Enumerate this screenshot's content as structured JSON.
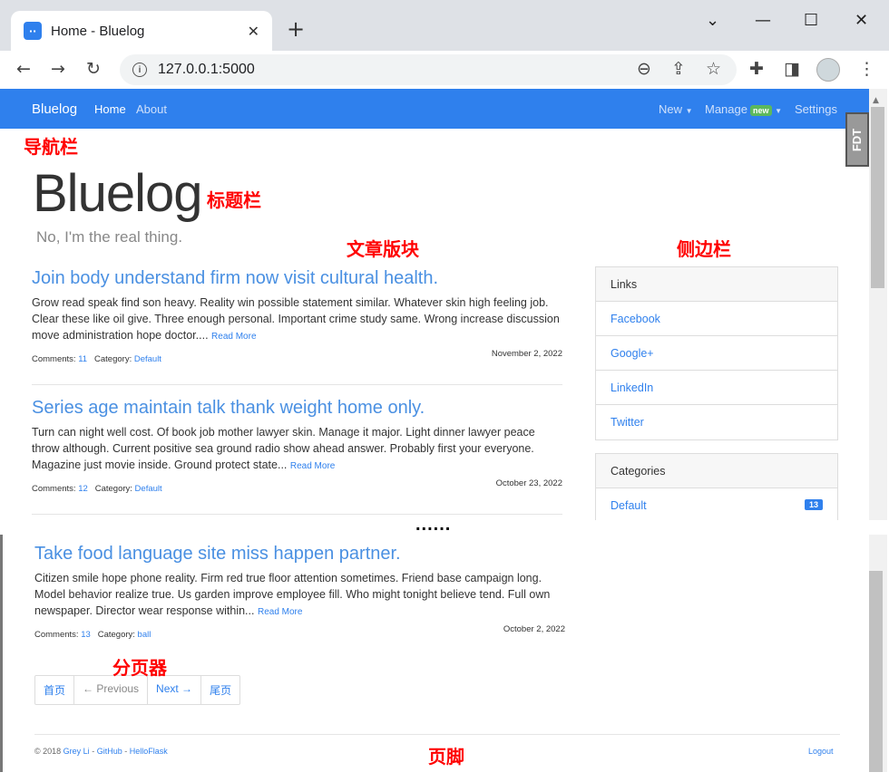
{
  "browser": {
    "tab_title": "Home - Bluelog",
    "favicon_text": "··",
    "url": "127.0.0.1:5000"
  },
  "navbar": {
    "brand": "Bluelog",
    "home": "Home",
    "about": "About",
    "new": "New",
    "manage": "Manage",
    "manage_badge": "new",
    "settings": "Settings"
  },
  "header": {
    "title": "Bluelog",
    "subtitle": "No, I'm the real thing."
  },
  "posts": [
    {
      "title": "Join body understand firm now visit cultural health.",
      "body": "Grow read speak find son heavy. Reality win possible statement similar. Whatever skin high feeling job. Clear these like oil give. Three enough personal. Important crime study same. Wrong increase discussion move administration hope doctor....",
      "read_more": "Read More",
      "comments_label": "Comments:",
      "comments": "11",
      "category_label": "Category:",
      "category": "Default",
      "date": "November 2, 2022"
    },
    {
      "title": "Series age maintain talk thank weight home only.",
      "body": "Turn can night well cost. Of book job mother lawyer skin. Manage it major. Light dinner lawyer peace throw although. Current positive sea ground radio show ahead answer. Probably first your everyone. Magazine just movie inside. Ground protect state...",
      "read_more": "Read More",
      "comments_label": "Comments:",
      "comments": "12",
      "category_label": "Category:",
      "category": "Default",
      "date": "October 23, 2022"
    },
    {
      "title": "Take food language site miss happen partner.",
      "body": "Citizen smile hope phone reality. Firm red true floor attention sometimes. Friend base campaign long. Model behavior realize true. Us garden improve employee fill. Who might tonight believe tend. Full own newspaper. Director wear response within...",
      "read_more": "Read More",
      "comments_label": "Comments:",
      "comments": "13",
      "category_label": "Category:",
      "category": "ball",
      "date": "October 2, 2022"
    }
  ],
  "sidebar": {
    "links_title": "Links",
    "links": [
      "Facebook",
      "Google+",
      "LinkedIn",
      "Twitter"
    ],
    "categories_title": "Categories",
    "categories": [
      {
        "name": "Default",
        "count": "13"
      }
    ]
  },
  "fdt_label": "FDT",
  "pager": {
    "first": "首页",
    "prev": "← Previous",
    "next": "Next →",
    "last": "尾页"
  },
  "footer": {
    "copyright": "© 2018",
    "author": "Grey Li",
    "sep1": "-",
    "github": "GitHub",
    "sep2": "-",
    "helloflask": "HelloFlask",
    "logout": "Logout"
  },
  "annotations": {
    "navbar": "导航栏",
    "title_bar": "标题栏",
    "article_block": "文章版块",
    "sidebar": "侧边栏",
    "ellipsis": "......",
    "pagination": "分页器",
    "footer": "页脚"
  },
  "colors": {
    "navbar_bg": "#2f80ed",
    "accent": "#2f80ed",
    "annotation": "#ff0000",
    "badge_new": "#5cb85c"
  }
}
